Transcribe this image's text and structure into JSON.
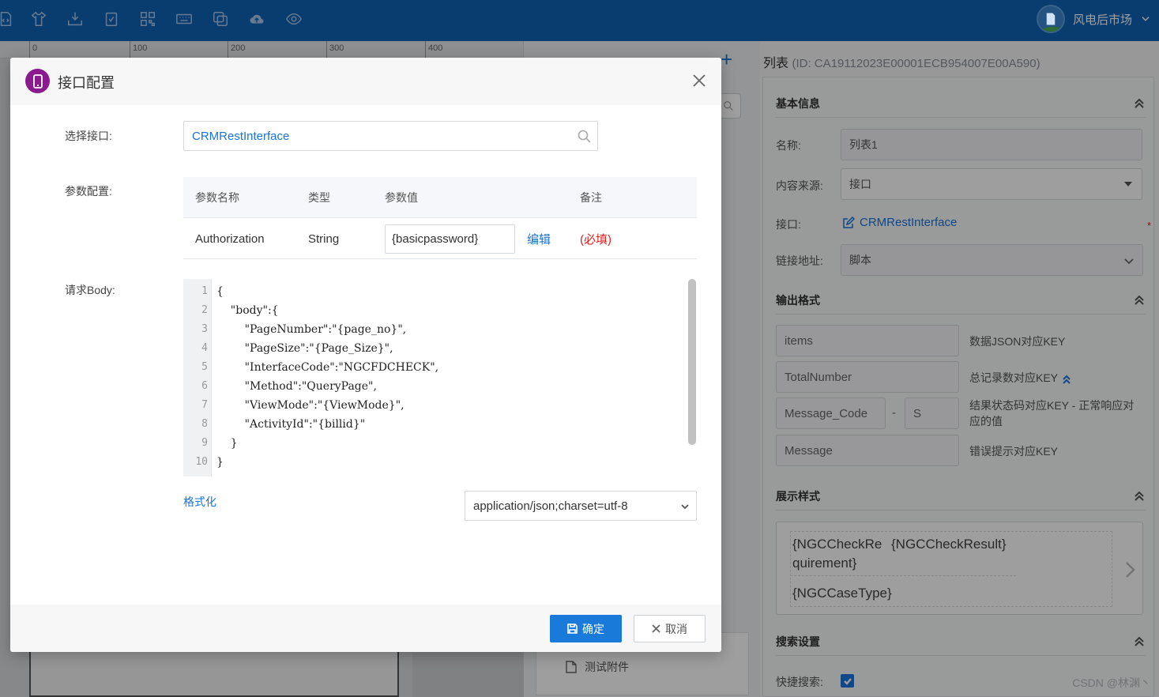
{
  "toolbar": {
    "icons": [
      "file-code-icon",
      "shirt-icon",
      "download-tray-icon",
      "clipboard-check-icon",
      "qr-code-icon",
      "keyboard-icon",
      "copy-window-icon",
      "cloud-upload-icon",
      "eye-icon"
    ],
    "user_name": "风电后市场"
  },
  "ruler": {
    "ticks": [
      "0",
      "100",
      "200",
      "300",
      "400"
    ]
  },
  "middle_panel": {
    "list_item": "测试附件"
  },
  "properties": {
    "title": "列表",
    "id": "(ID: CA19112023E00001ECB954007E00A590)",
    "basic": {
      "header": "基本信息",
      "name_label": "名称:",
      "name_value": "列表1",
      "source_label": "内容来源:",
      "source_value": "接口",
      "interface_label": "接口:",
      "interface_value": "CRMRestInterface",
      "required_mark": "*",
      "link_label": "链接地址:",
      "link_value": "脚本"
    },
    "output": {
      "header": "输出格式",
      "items_key": "items",
      "items_desc": "数据JSON对应KEY",
      "total_key": "TotalNumber",
      "total_desc": "总记录数对应KEY",
      "msgcode_key": "Message_Code",
      "msgcode_sep": "-",
      "msgcode_val": "S",
      "msgcode_desc": "结果状态码对应KEY - 正常响应对应的值",
      "message_key": "Message",
      "message_desc": "错误提示对应KEY"
    },
    "display": {
      "header": "展示样式",
      "field1": "{NGCCheckRequirement}",
      "field2": "{NGCCheckResult}",
      "field3": "{NGCCaseType}"
    },
    "search": {
      "header": "搜索设置",
      "quick_label": "快捷搜索:",
      "quick_checked": true
    }
  },
  "dialog": {
    "title": "接口配置",
    "interface_label": "选择接口:",
    "interface_value": "CRMRestInterface",
    "params_label": "参数配置:",
    "params_headers": [
      "参数名称",
      "类型",
      "参数值",
      "备注"
    ],
    "params_rows": [
      {
        "name": "Authorization",
        "type": "String",
        "value": "{basicpassword}",
        "edit": "编辑",
        "note": "(必填)"
      }
    ],
    "body_label": "请求Body:",
    "body_lines": [
      "{",
      "    \"body\":{",
      "        \"PageNumber\":\"{page_no}\",",
      "        \"PageSize\":\"{Page_Size}\",",
      "        \"InterfaceCode\":\"NGCFDCHECK\",",
      "        \"Method\":\"QueryPage\",",
      "        \"ViewMode\":\"{ViewMode}\",",
      "        \"ActivityId\":\"{billid}\"",
      "    }",
      "}"
    ],
    "format_link": "格式化",
    "content_type": "application/json;charset=utf-8",
    "ok_label": "确定",
    "cancel_label": "取消"
  },
  "watermark": "CSDN @林渊丶",
  "colors": {
    "toolbar_bg": "#0f63b5",
    "primary": "#1a7ad9",
    "required": "#e02020",
    "dialog_logo": "#8b1a8e"
  }
}
